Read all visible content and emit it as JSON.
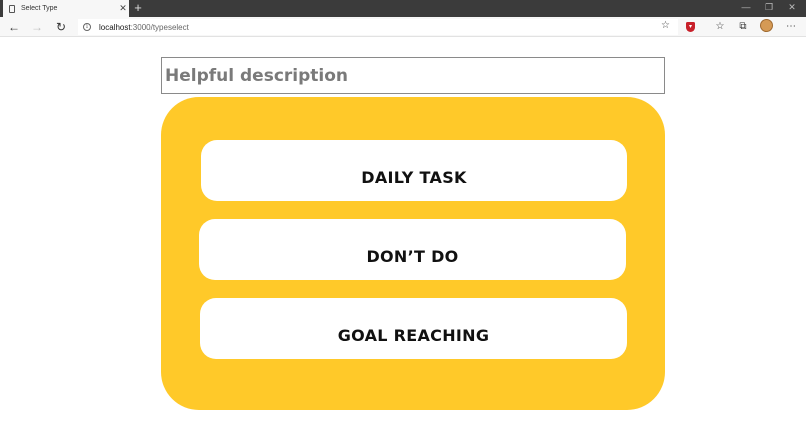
{
  "browser": {
    "tab_title": "Select Type",
    "tab_close": "✕",
    "new_tab": "+",
    "window_controls": {
      "minimize": "—",
      "restore": "❐",
      "close": "✕"
    },
    "url_host": "localhost",
    "url_path": ":3000/typeselect",
    "icons": [
      "back-icon",
      "forward-icon",
      "refresh-icon",
      "info-icon",
      "star-icon",
      "shield-extension-icon",
      "favorites-icon",
      "collections-icon",
      "profile-avatar",
      "more-icon"
    ]
  },
  "page": {
    "description_placeholder": "Helpful description",
    "options": [
      "DAILY TASK",
      "DON’T DO",
      "GOAL REACHING"
    ],
    "colors": {
      "panel": "#ffc929",
      "option_bg": "#ffffff",
      "text": "#111111"
    }
  }
}
